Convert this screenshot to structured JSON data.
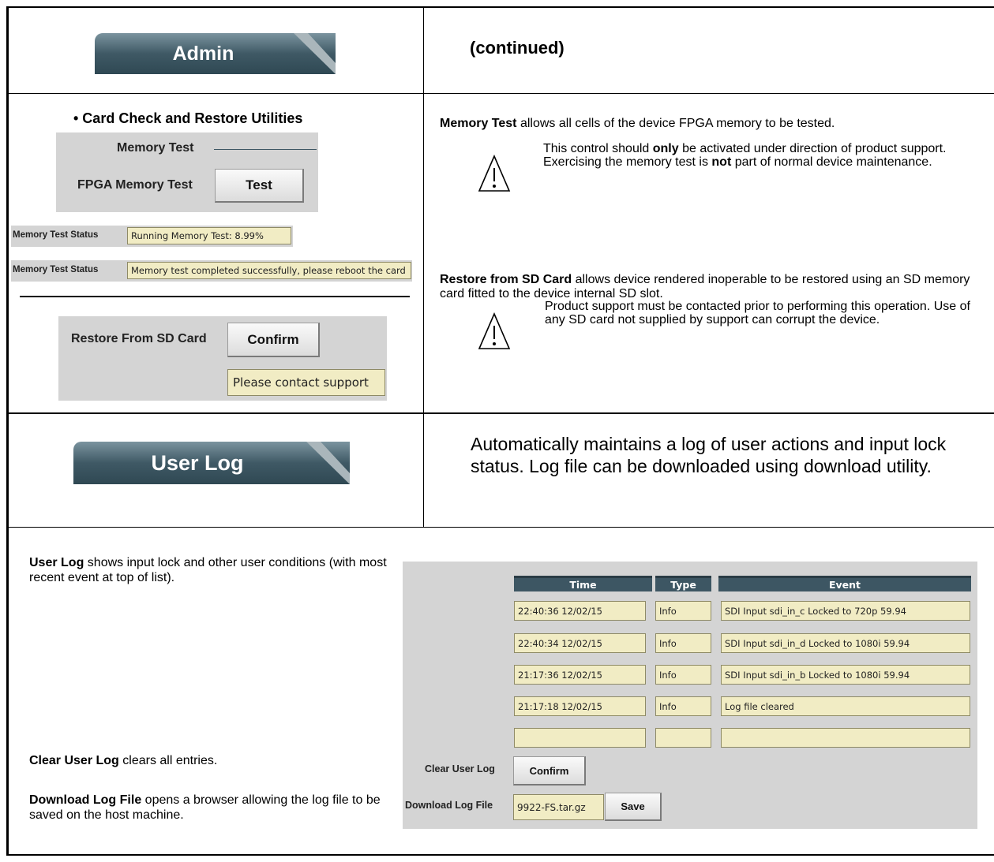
{
  "admin_tab": {
    "label": "Admin"
  },
  "continued": "(continued)",
  "card_check": {
    "heading": "• Card Check and Restore Utilities",
    "memory_test_label": "Memory Test",
    "fpga_label": "FPGA Memory Test",
    "test_button": "Test",
    "status_label": "Memory Test Status",
    "status_running": "Running Memory Test: 8.99%",
    "status_done": "Memory test completed successfully, please reboot the card",
    "restore_label": "Restore From SD Card",
    "confirm_button": "Confirm",
    "contact_field": "Please contact support"
  },
  "memory_desc": {
    "bold": "Memory Test",
    "rest": " allows all cells of the device FPGA memory to be tested.",
    "warn_1": "This control should ",
    "warn_only": "only",
    "warn_2": " be activated under direction of product support. Exercising the memory test is ",
    "warn_not": "not",
    "warn_3": " part of normal device maintenance."
  },
  "restore_desc": {
    "bold": "Restore from SD Card",
    "rest": " allows device rendered inoperable to be restored using an SD memory card fitted to the device internal SD slot.",
    "warn": "Product support must be contacted prior to performing this operation. Use of any SD card not supplied by support can corrupt the device."
  },
  "user_log_tab": {
    "label": "User Log"
  },
  "user_log_summary": "Automatically maintains a log of user actions and input lock status. Log file can be downloaded using download utility.",
  "user_log_desc": {
    "bold": "User Log",
    "rest": " shows input lock and other user conditions (with most recent event at top of list)."
  },
  "clear_desc": {
    "bold": "Clear User Log",
    "rest": " clears all entries."
  },
  "download_desc": {
    "bold": "Download Log File",
    "rest": " opens a browser allowing the log file to be saved on the host machine."
  },
  "log_table": {
    "headers": {
      "time": "Time",
      "type": "Type",
      "event": "Event"
    },
    "rows": [
      {
        "time": "22:40:36 12/02/15",
        "type": "Info",
        "event": "SDI Input sdi_in_c Locked to 720p 59.94"
      },
      {
        "time": "22:40:34 12/02/15",
        "type": "Info",
        "event": "SDI Input sdi_in_d Locked to 1080i 59.94"
      },
      {
        "time": "21:17:36 12/02/15",
        "type": "Info",
        "event": "SDI Input sdi_in_b Locked to 1080i 59.94"
      },
      {
        "time": "21:17:18 12/02/15",
        "type": "Info",
        "event": "Log file cleared"
      },
      {
        "time": "",
        "type": "",
        "event": ""
      }
    ],
    "clear_label": "Clear User Log",
    "clear_button": "Confirm",
    "download_label": "Download Log File",
    "download_field": "9922-FS.tar.gz",
    "save_button": "Save"
  }
}
